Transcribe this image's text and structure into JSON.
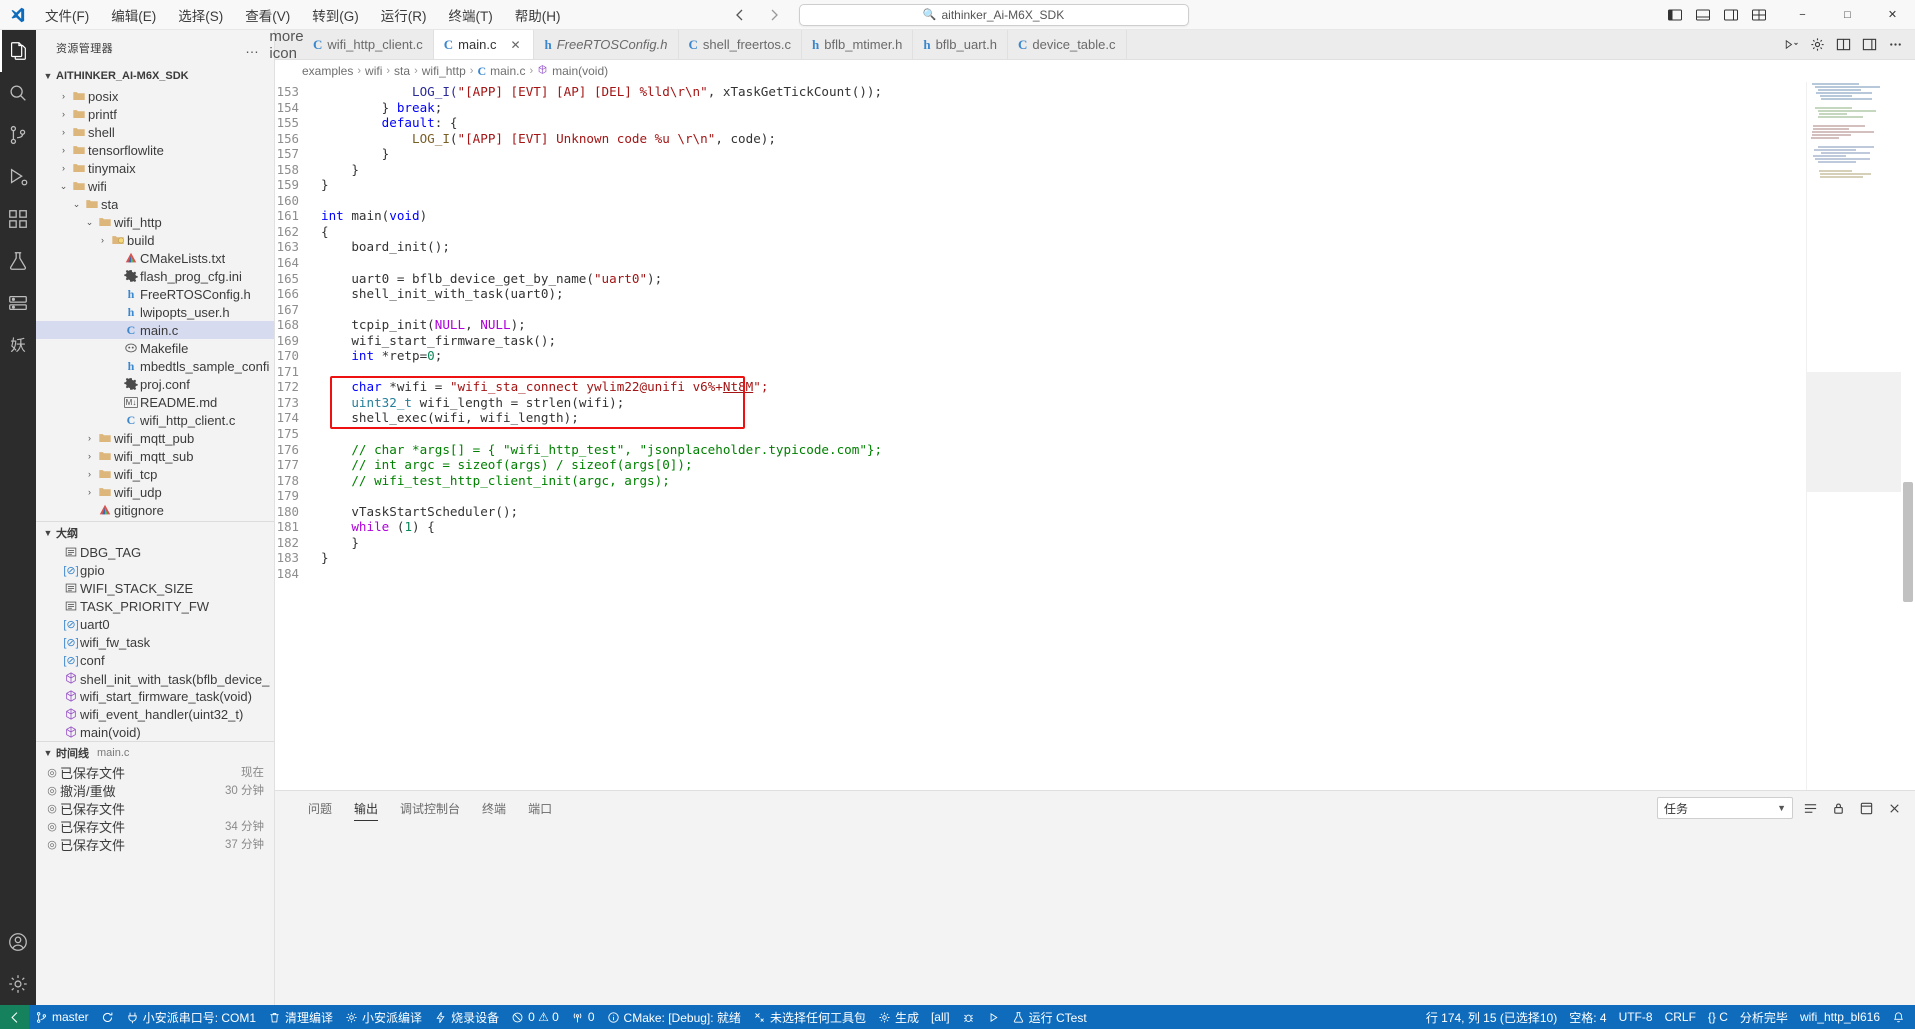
{
  "titlebar": {
    "logo_icon": "vscode-logo-icon",
    "menus": [
      "文件(F)",
      "编辑(E)",
      "选择(S)",
      "查看(V)",
      "转到(G)",
      "运行(R)",
      "终端(T)",
      "帮助(H)"
    ],
    "back_icon": "arrow-left-icon",
    "forward_icon": "arrow-right-icon",
    "command_center_text": "aithinker_Ai-M6X_SDK",
    "command_center_icon": "search-icon",
    "layout_icons": [
      "toggle-primary-sidebar-icon",
      "toggle-panel-icon",
      "toggle-secondary-sidebar-icon",
      "customize-layout-icon"
    ],
    "window_minimize": "−",
    "window_maximize": "□",
    "window_close": "✕"
  },
  "activitybar": {
    "items": [
      {
        "name": "explorer",
        "icon": "files-icon",
        "active": true
      },
      {
        "name": "search",
        "icon": "search-icon",
        "active": false
      },
      {
        "name": "source-control",
        "icon": "source-control-icon",
        "active": false
      },
      {
        "name": "run-and-debug",
        "icon": "run-debug-icon",
        "active": false
      },
      {
        "name": "extensions",
        "icon": "extensions-icon",
        "active": false
      },
      {
        "name": "testing",
        "icon": "beaker-icon",
        "active": false
      },
      {
        "name": "remote-explorer",
        "icon": "remote-icon",
        "active": false
      },
      {
        "name": "custom-extension",
        "icon": "chinese-glyph-icon",
        "active": false
      }
    ],
    "bottom": [
      {
        "name": "accounts",
        "icon": "account-icon"
      },
      {
        "name": "manage-settings",
        "icon": "gear-icon"
      }
    ]
  },
  "sidebar": {
    "title": "资源管理器",
    "more_actions": "…",
    "project": {
      "label": "AITHINKER_AI-M6X_SDK",
      "expanded": true
    },
    "tree": [
      {
        "label": "posix",
        "type": "folder",
        "depth": 1,
        "expanded": false
      },
      {
        "label": "printf",
        "type": "folder",
        "depth": 1,
        "expanded": false
      },
      {
        "label": "shell",
        "type": "folder",
        "depth": 1,
        "expanded": false
      },
      {
        "label": "tensorflowlite",
        "type": "folder",
        "depth": 1,
        "expanded": false
      },
      {
        "label": "tinymaix",
        "type": "folder",
        "depth": 1,
        "expanded": false
      },
      {
        "label": "wifi",
        "type": "folder",
        "depth": 1,
        "expanded": true
      },
      {
        "label": "sta",
        "type": "folder",
        "depth": 2,
        "expanded": true
      },
      {
        "label": "wifi_http",
        "type": "folder",
        "depth": 3,
        "expanded": true
      },
      {
        "label": "build",
        "type": "folder-special",
        "depth": 4,
        "expanded": false
      },
      {
        "label": "CMakeLists.txt",
        "type": "cmake",
        "depth": 5
      },
      {
        "label": "flash_prog_cfg.ini",
        "type": "gear",
        "depth": 5
      },
      {
        "label": "FreeRTOSConfig.h",
        "type": "h",
        "depth": 5
      },
      {
        "label": "lwipopts_user.h",
        "type": "h",
        "depth": 5
      },
      {
        "label": "main.c",
        "type": "c",
        "depth": 5,
        "selected": true
      },
      {
        "label": "Makefile",
        "type": "makefile",
        "depth": 5
      },
      {
        "label": "mbedtls_sample_config.h",
        "type": "h",
        "depth": 5
      },
      {
        "label": "proj.conf",
        "type": "gear",
        "depth": 5
      },
      {
        "label": "README.md",
        "type": "md",
        "depth": 5
      },
      {
        "label": "wifi_http_client.c",
        "type": "c",
        "depth": 5
      },
      {
        "label": "wifi_mqtt_pub",
        "type": "folder",
        "depth": 3,
        "expanded": false
      },
      {
        "label": "wifi_mqtt_sub",
        "type": "folder",
        "depth": 3,
        "expanded": false
      },
      {
        "label": "wifi_tcp",
        "type": "folder",
        "depth": 3,
        "expanded": false
      },
      {
        "label": "wifi_udp",
        "type": "folder",
        "depth": 3,
        "expanded": false
      },
      {
        "label": "gitignore",
        "type": "cmake",
        "depth": 3
      }
    ],
    "outline": {
      "title": "大纲",
      "expanded": true,
      "items": [
        {
          "label": "DBG_TAG",
          "kind": "constant"
        },
        {
          "label": "gpio",
          "kind": "variable"
        },
        {
          "label": "WIFI_STACK_SIZE",
          "kind": "constant"
        },
        {
          "label": "TASK_PRIORITY_FW",
          "kind": "constant"
        },
        {
          "label": "uart0",
          "kind": "variable"
        },
        {
          "label": "wifi_fw_task",
          "kind": "variable"
        },
        {
          "label": "conf",
          "kind": "variable"
        },
        {
          "label": "shell_init_with_task(bflb_device_s *) 声明",
          "kind": "function"
        },
        {
          "label": "wifi_start_firmware_task(void)",
          "kind": "function"
        },
        {
          "label": "wifi_event_handler(uint32_t)",
          "kind": "function"
        },
        {
          "label": "main(void)",
          "kind": "function"
        }
      ]
    },
    "timeline": {
      "title": "时间线",
      "subtitle": "main.c",
      "expanded": true,
      "items": [
        {
          "label": "已保存文件",
          "when": "现在"
        },
        {
          "label": "撤消/重做",
          "when": "30 分钟"
        },
        {
          "label": "已保存文件",
          "when": ""
        },
        {
          "label": "已保存文件",
          "when": "34 分钟"
        },
        {
          "label": "已保存文件",
          "when": "37 分钟"
        }
      ]
    }
  },
  "editor": {
    "tabs": [
      {
        "label": "wifi_http_client.c",
        "icon": "c",
        "active": false,
        "italic": false,
        "closable": false
      },
      {
        "label": "main.c",
        "icon": "c",
        "active": true,
        "italic": false,
        "closable": true
      },
      {
        "label": "FreeRTOSConfig.h",
        "icon": "h",
        "active": false,
        "italic": true,
        "closable": false
      },
      {
        "label": "shell_freertos.c",
        "icon": "c",
        "active": false,
        "italic": false,
        "closable": false
      },
      {
        "label": "bflb_mtimer.h",
        "icon": "h",
        "active": false,
        "italic": false,
        "closable": false
      },
      {
        "label": "bflb_uart.h",
        "icon": "h",
        "active": false,
        "italic": false,
        "closable": false
      },
      {
        "label": "device_table.c",
        "icon": "c",
        "active": false,
        "italic": false,
        "closable": false
      }
    ],
    "tab_overflow_icon": "more-icon",
    "tab_actions": [
      {
        "name": "run-or-debug",
        "icon": "run-chevron-icon"
      },
      {
        "name": "settings",
        "icon": "gear-icon"
      },
      {
        "name": "split-editor-right",
        "icon": "split-editor-icon"
      },
      {
        "name": "toggle-layout",
        "icon": "layout-icon"
      },
      {
        "name": "more-actions",
        "icon": "ellipsis-icon"
      }
    ],
    "breadcrumb": [
      "examples",
      "wifi",
      "sta",
      "wifi_http",
      "main.c",
      "main(void)"
    ],
    "first_line_number": 153,
    "lines": [
      {
        "n": 153,
        "segments": [
          {
            "t": "            LOG_I(\"[APP] [EVT] [AP] [DEL] %lld\\r\\n\", xTaskGetTickCount());",
            "c": "partial"
          }
        ]
      },
      {
        "n": 154,
        "segments": [
          {
            "t": "        } ",
            "c": ""
          },
          {
            "t": "break",
            "c": "kw"
          },
          {
            "t": ";",
            "c": ""
          }
        ]
      },
      {
        "n": 155,
        "segments": [
          {
            "t": "        ",
            "c": ""
          },
          {
            "t": "default",
            "c": "kw"
          },
          {
            "t": ": {",
            "c": ""
          }
        ]
      },
      {
        "n": 156,
        "segments": [
          {
            "t": "            ",
            "c": ""
          },
          {
            "t": "LOG_I",
            "c": "fn"
          },
          {
            "t": "(",
            "c": ""
          },
          {
            "t": "\"[APP] [EVT] Unknown code %u \\r\\n\"",
            "c": "str"
          },
          {
            "t": ", code);",
            "c": ""
          }
        ]
      },
      {
        "n": 157,
        "segments": [
          {
            "t": "        }",
            "c": ""
          }
        ]
      },
      {
        "n": 158,
        "segments": [
          {
            "t": "    }",
            "c": ""
          }
        ]
      },
      {
        "n": 159,
        "segments": [
          {
            "t": "}",
            "c": ""
          }
        ]
      },
      {
        "n": 160,
        "segments": []
      },
      {
        "n": 161,
        "segments": [
          {
            "t": "int",
            "c": "kw"
          },
          {
            "t": " main(",
            "c": ""
          },
          {
            "t": "void",
            "c": "kw"
          },
          {
            "t": ")",
            "c": ""
          }
        ]
      },
      {
        "n": 162,
        "segments": [
          {
            "t": "{",
            "c": ""
          }
        ]
      },
      {
        "n": 163,
        "segments": [
          {
            "t": "    board_init();",
            "c": ""
          }
        ]
      },
      {
        "n": 164,
        "segments": []
      },
      {
        "n": 165,
        "segments": [
          {
            "t": "    uart0 = bflb_device_get_by_name(",
            "c": ""
          },
          {
            "t": "\"uart0\"",
            "c": "str"
          },
          {
            "t": ");",
            "c": ""
          }
        ]
      },
      {
        "n": 166,
        "segments": [
          {
            "t": "    shell_init_with_task(uart0);",
            "c": ""
          }
        ]
      },
      {
        "n": 167,
        "segments": []
      },
      {
        "n": 168,
        "segments": [
          {
            "t": "    tcpip_init(",
            "c": ""
          },
          {
            "t": "NULL",
            "c": "kw2"
          },
          {
            "t": ", ",
            "c": ""
          },
          {
            "t": "NULL",
            "c": "kw2"
          },
          {
            "t": ");",
            "c": ""
          }
        ]
      },
      {
        "n": 169,
        "segments": [
          {
            "t": "    wifi_start_firmware_task();",
            "c": ""
          }
        ]
      },
      {
        "n": 170,
        "segments": [
          {
            "t": "    ",
            "c": ""
          },
          {
            "t": "int",
            "c": "kw"
          },
          {
            "t": " *retp=",
            "c": ""
          },
          {
            "t": "0",
            "c": "num"
          },
          {
            "t": ";",
            "c": ""
          }
        ]
      },
      {
        "n": 171,
        "segments": []
      },
      {
        "n": 172,
        "segments": [
          {
            "t": "    ",
            "c": ""
          },
          {
            "t": "char",
            "c": "kw"
          },
          {
            "t": " *wifi = ",
            "c": ""
          },
          {
            "t": "\"wifi_sta_connect ywlim22@unifi v6%+",
            "c": "str"
          },
          {
            "t": "Nt8M",
            "c": "str underline"
          },
          {
            "t": "\";",
            "c": "str"
          }
        ]
      },
      {
        "n": 173,
        "segments": [
          {
            "t": "    ",
            "c": ""
          },
          {
            "t": "uint32_t",
            "c": "typ"
          },
          {
            "t": " wifi_length = strlen(wifi);",
            "c": ""
          }
        ]
      },
      {
        "n": 174,
        "segments": [
          {
            "t": "    shell_exec(wifi, wifi_length);",
            "c": ""
          }
        ]
      },
      {
        "n": 175,
        "segments": []
      },
      {
        "n": 176,
        "segments": [
          {
            "t": "    // char *args[] = { \"wifi_http_test\", \"jsonplaceholder.typicode.com\"};",
            "c": "cmt"
          }
        ]
      },
      {
        "n": 177,
        "segments": [
          {
            "t": "    // int argc = sizeof(args) / sizeof(args[0]);",
            "c": "cmt"
          }
        ]
      },
      {
        "n": 178,
        "segments": [
          {
            "t": "    // wifi_test_http_client_init(argc, args);",
            "c": "cmt"
          }
        ]
      },
      {
        "n": 179,
        "segments": []
      },
      {
        "n": 180,
        "segments": [
          {
            "t": "    vTaskStartScheduler();",
            "c": ""
          }
        ]
      },
      {
        "n": 181,
        "segments": [
          {
            "t": "    ",
            "c": ""
          },
          {
            "t": "while",
            "c": "kw2"
          },
          {
            "t": " (",
            "c": ""
          },
          {
            "t": "1",
            "c": "num"
          },
          {
            "t": ") {",
            "c": ""
          }
        ]
      },
      {
        "n": 182,
        "segments": [
          {
            "t": "    }",
            "c": ""
          }
        ]
      },
      {
        "n": 183,
        "segments": [
          {
            "t": "}",
            "c": ""
          }
        ]
      },
      {
        "n": 184,
        "segments": []
      }
    ],
    "highlight": {
      "from_line": 172,
      "to_line": 174,
      "color": "#ee1111"
    }
  },
  "panel": {
    "tabs": [
      "问题",
      "输出",
      "调试控制台",
      "终端",
      "端口"
    ],
    "active_tab": "输出",
    "filter_value": "任务",
    "filter_chevron": "chevron-down-icon",
    "actions": [
      {
        "name": "clear-output",
        "icon": "list-icon"
      },
      {
        "name": "lock-scrolling",
        "icon": "lock-icon"
      },
      {
        "name": "open-new-window",
        "icon": "new-window-icon"
      },
      {
        "name": "close-panel",
        "icon": "close-icon"
      }
    ],
    "content": ""
  },
  "statusbar": {
    "remote": {
      "icon": "remote-indicator-icon",
      "label": ""
    },
    "left": [
      {
        "name": "branch",
        "icon": "source-control-icon",
        "label": "master"
      },
      {
        "name": "sync",
        "icon": "sync-icon",
        "label": ""
      },
      {
        "name": "serial-port",
        "icon": "plug-icon",
        "label": "小安派串口号: COM1"
      },
      {
        "name": "clean-build",
        "icon": "trash-icon",
        "label": "清理编译"
      },
      {
        "name": "build",
        "icon": "gear-icon",
        "label": "小安派编译"
      },
      {
        "name": "flash-device",
        "icon": "zap-icon",
        "label": "烧录设备"
      },
      {
        "name": "problems",
        "icon": "error-warning-icon",
        "label": "0 ⚠ 0"
      },
      {
        "name": "ports",
        "icon": "radio-tower-icon",
        "label": "0"
      },
      {
        "name": "cmake-status",
        "icon": "info-icon",
        "label": "CMake: [Debug]: 就绪"
      },
      {
        "name": "cmake-kit",
        "icon": "tools-icon",
        "label": "未选择任何工具包"
      },
      {
        "name": "cmake-build",
        "icon": "gear-icon",
        "label": "生成"
      },
      {
        "name": "build-target",
        "icon": "",
        "label": "[all]"
      },
      {
        "name": "cmake-debug",
        "icon": "bug-icon",
        "label": ""
      },
      {
        "name": "cmake-launch",
        "icon": "play-icon",
        "label": ""
      },
      {
        "name": "run-ctest",
        "icon": "beaker-icon",
        "label": "运行 CTest"
      }
    ],
    "right": [
      {
        "name": "cursor-position",
        "label": "行 174, 列 15 (已选择10)"
      },
      {
        "name": "indentation",
        "label": "空格: 4"
      },
      {
        "name": "encoding",
        "label": "UTF-8"
      },
      {
        "name": "eol",
        "label": "CRLF"
      },
      {
        "name": "language-mode",
        "label": "{} C"
      },
      {
        "name": "analysis-status",
        "label": "分析完毕"
      },
      {
        "name": "build-config",
        "label": "wifi_http_bl616"
      },
      {
        "name": "notifications",
        "label": "",
        "icon": "bell-icon"
      }
    ]
  },
  "minimap": {
    "groups": [
      {
        "color": "#9fb5cf",
        "rows": [
          50,
          70,
          45,
          60,
          35,
          55
        ]
      },
      {
        "color": "#b2c9a8",
        "rows": [
          40,
          62,
          30,
          48
        ]
      },
      {
        "color": "#c5a9a9",
        "rows": [
          55,
          38,
          66,
          42,
          30
        ]
      },
      {
        "color": "#a8b8cf",
        "rows": [
          60,
          44,
          52,
          35,
          58,
          40
        ]
      },
      {
        "color": "#c9c0a0",
        "rows": [
          36,
          54,
          46
        ]
      }
    ]
  }
}
